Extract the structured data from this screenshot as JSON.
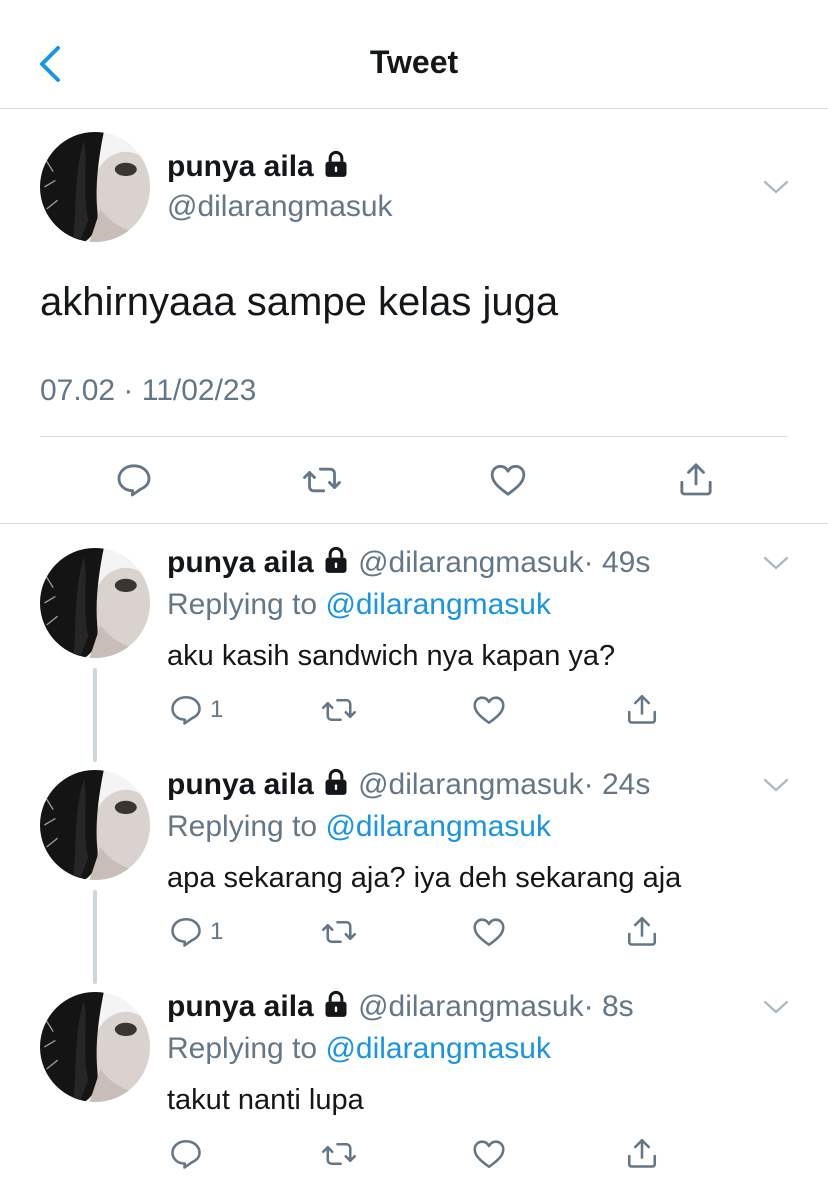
{
  "header": {
    "title": "Tweet",
    "back_icon": "chevron-left-icon"
  },
  "colors": {
    "accent": "#1b95e0",
    "secondary_text": "#657786",
    "divider": "#d7dbde",
    "thread_line": "#ccd6dd"
  },
  "main_tweet": {
    "name": "punya aila",
    "handle": "@dilarangmasuk",
    "protected_icon": "lock-icon",
    "text": "akhirnyaaa sampe kelas juga",
    "timestamp": "07.02 · 11/02/23",
    "actions": [
      "reply-icon",
      "retweet-icon",
      "like-icon",
      "share-icon"
    ]
  },
  "replies": [
    {
      "name": "punya aila",
      "handle": "@dilarangmasuk",
      "time": "· 49s",
      "replying_label": "Replying to",
      "replying_to": "@dilarangmasuk",
      "text": "aku kasih sandwich nya kapan ya?",
      "reply_count": "1"
    },
    {
      "name": "punya aila",
      "handle": "@dilarangmasuk",
      "time": "· 24s",
      "replying_label": "Replying to",
      "replying_to": "@dilarangmasuk",
      "text": "apa sekarang aja? iya deh sekarang aja",
      "reply_count": "1"
    },
    {
      "name": "punya aila",
      "handle": "@dilarangmasuk",
      "time": "· 8s",
      "replying_label": "Replying to",
      "replying_to": "@dilarangmasuk",
      "text": "takut nanti lupa",
      "reply_count": ""
    }
  ]
}
